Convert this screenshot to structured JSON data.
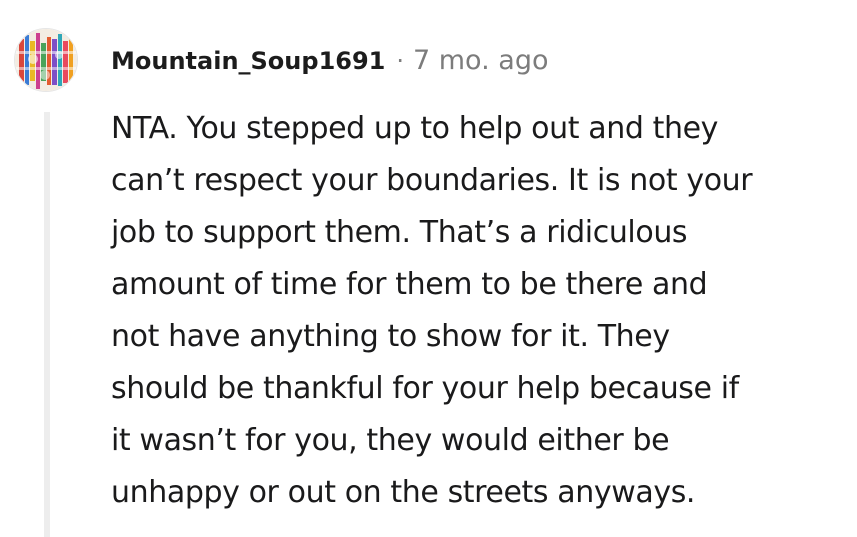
{
  "comment": {
    "author": "Mountain_Soup1691",
    "separator": "·",
    "timestamp": "7 mo. ago",
    "avatar_icon": "user-avatar-icon",
    "body_lines": [
      "NTA. You stepped up to help out and they",
      "can’t respect your boundaries. It is not your",
      "job to support them. That’s a ridiculous",
      "amount of time for them to be there and",
      "not have anything to show for it. They",
      "should be thankful for your help because if",
      "it wasn’t for you, they would either be",
      "unhappy or out on the streets anyways."
    ]
  },
  "colors": {
    "username": "#1c1c1c",
    "meta": "#7c7c7c",
    "body": "#1a1a1b",
    "thread_line": "#ededed"
  }
}
